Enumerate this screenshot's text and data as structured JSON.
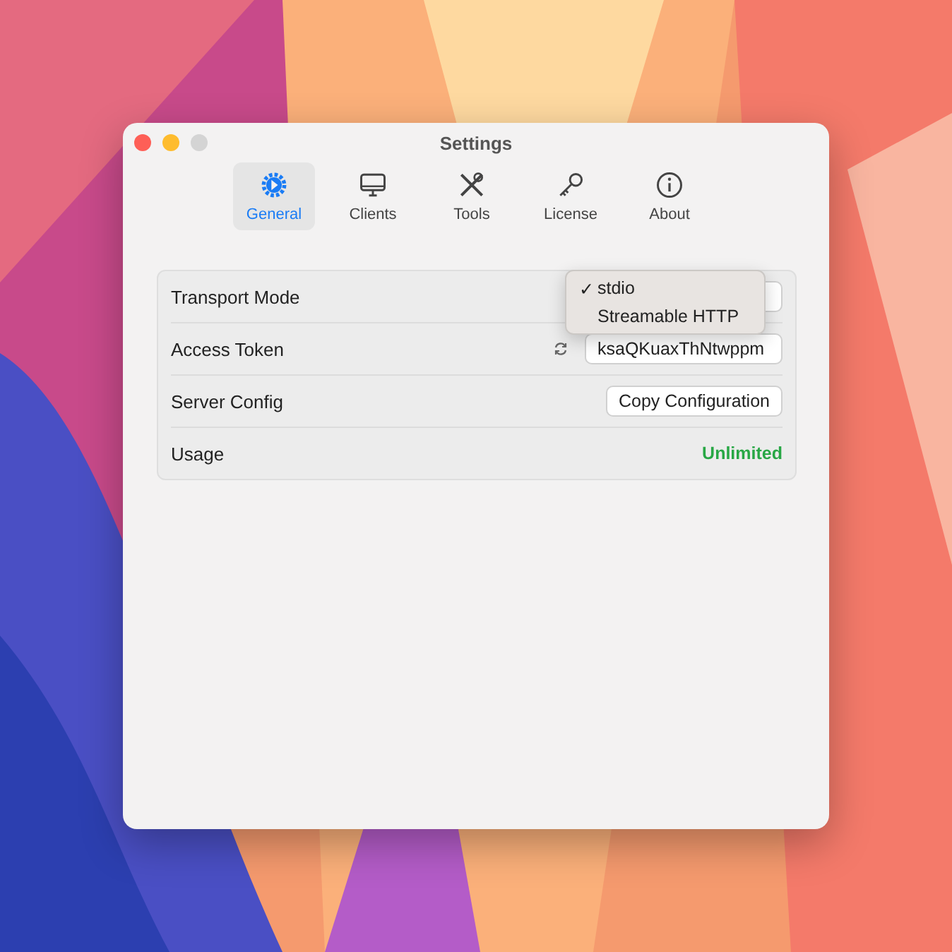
{
  "window": {
    "title": "Settings"
  },
  "tabs": [
    {
      "label": "General",
      "selected": true,
      "kind": "gear"
    },
    {
      "label": "Clients",
      "selected": false,
      "kind": "monitor"
    },
    {
      "label": "Tools",
      "selected": false,
      "kind": "tools"
    },
    {
      "label": "License",
      "selected": false,
      "kind": "key"
    },
    {
      "label": "About",
      "selected": false,
      "kind": "info"
    }
  ],
  "settings": [
    {
      "label": "Transport Mode",
      "kind": "select"
    },
    {
      "label": "Access Token",
      "kind": "token",
      "value": "ksaQKuaxThNtwppm"
    },
    {
      "label": "Server Config",
      "kind": "button",
      "button": "Copy Configuration"
    },
    {
      "label": "Usage",
      "kind": "status",
      "value": "Unlimited",
      "color": "#28a745"
    }
  ],
  "menu": {
    "items": [
      {
        "label": "stdio",
        "selected": true
      },
      {
        "label": "Streamable HTTP",
        "selected": false
      }
    ],
    "check": "✓"
  }
}
